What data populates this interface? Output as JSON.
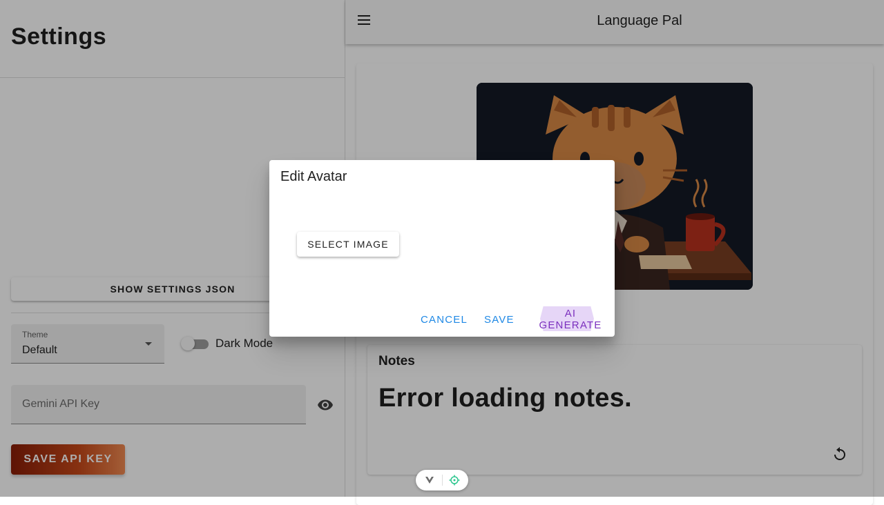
{
  "settings": {
    "title": "Settings",
    "show_json_label": "SHOW SETTINGS JSON",
    "theme": {
      "label": "Theme",
      "value": "Default"
    },
    "dark_mode_label": "Dark Mode",
    "dark_mode_on": false,
    "api_key": {
      "placeholder": "Gemini API Key",
      "value": ""
    },
    "save_api_key_label": "SAVE API KEY"
  },
  "header": {
    "menu_icon": "menu-icon",
    "title": "Language Pal"
  },
  "notes": {
    "title": "Notes",
    "message": "Error loading notes.",
    "refresh_icon": "refresh-icon"
  },
  "dialog": {
    "title": "Edit Avatar",
    "select_image_label": "SELECT IMAGE",
    "cancel_label": "CANCEL",
    "save_label": "SAVE",
    "ai_generate_label": "AI GENERATE"
  },
  "colors": {
    "primary": "#1e88e5",
    "ai_accent": "#7b2fbe",
    "save_api_gradient_start": "#8a1e08",
    "save_api_gradient_end": "#f08a52"
  }
}
